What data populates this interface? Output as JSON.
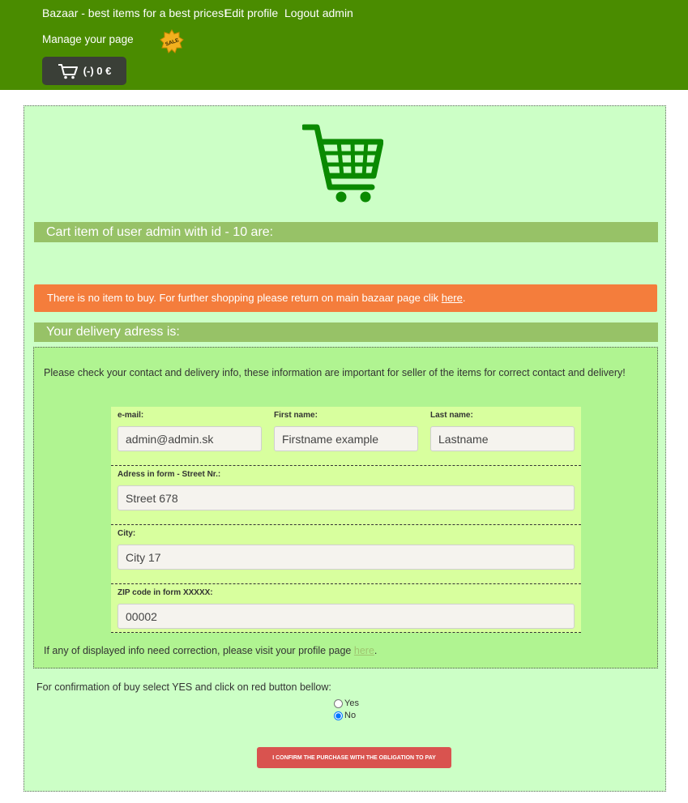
{
  "header": {
    "brand_link": "Bazaar - best items for a best prices!",
    "edit_profile": "Edit profile",
    "logout": "Logout admin",
    "manage_page": "Manage your page",
    "sale_badge": "SALE",
    "cart_summary": "(-) 0 €"
  },
  "main": {
    "cart_heading": "Cart item of user admin with id - 10 are:",
    "alert_text": "There is no item to buy. For further shopping please return on main bazaar page clik ",
    "alert_link": "here",
    "delivery_heading": "Your delivery adress is:",
    "delivery_info": "Please check your contact and delivery info, these information are important for seller of the items for correct contact and delivery!",
    "form": {
      "email_label": "e-mail:",
      "email_value": "admin@admin.sk",
      "first_name_label": "First name:",
      "first_name_value": "Firstname example",
      "last_name_label": "Last name:",
      "last_name_value": "Lastname",
      "street_label": "Adress in form - Street Nr.:",
      "street_value": "Street 678",
      "city_label": "City:",
      "city_value": "City 17",
      "zip_label": "ZIP code in form XXXXX:",
      "zip_value": "00002"
    },
    "correction_text": "If any of displayed info need correction, please visit your profile page ",
    "correction_link": "here",
    "confirm_instruction": "For confirmation of buy select YES and click on red button bellow:",
    "radio_yes": "Yes",
    "radio_no": "No",
    "radio_selected": "No",
    "confirm_button": "I confirm the purchase with the obligation to pay"
  },
  "colors": {
    "topbar": "#4a8c00",
    "main_bg": "#ccffc6",
    "section_bar": "#97c267",
    "alert": "#f47d3c",
    "delivery_box": "#b0f491",
    "form_panel": "#d8ff9e",
    "confirm_button": "#d9534f",
    "cart_icon": "#0a8a00"
  },
  "icons": {
    "header_cart": "shopping-cart-icon",
    "sale": "sale-badge-icon",
    "big_cart": "shopping-cart-icon"
  }
}
